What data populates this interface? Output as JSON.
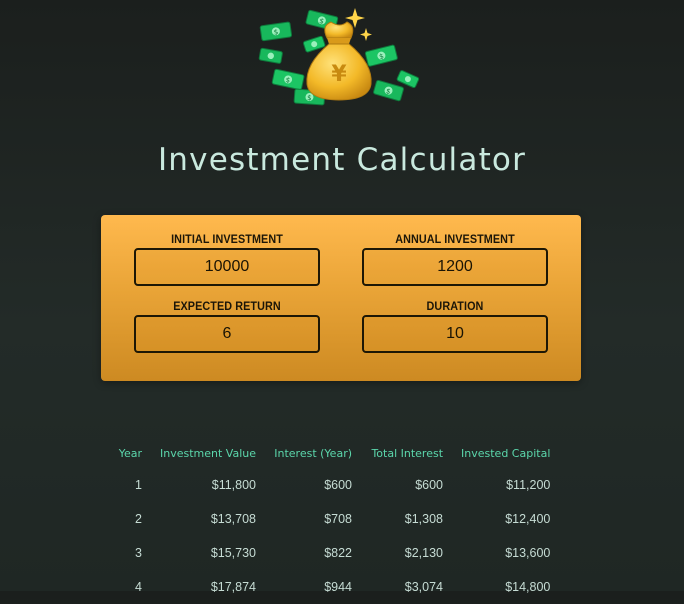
{
  "app": {
    "title": "Investment Calculator",
    "logo_icon": "money-bag-with-flying-cash-icon"
  },
  "inputs": {
    "initial_investment": {
      "label": "INITIAL INVESTMENT",
      "value": "10000"
    },
    "annual_investment": {
      "label": "ANNUAL INVESTMENT",
      "value": "1200"
    },
    "expected_return": {
      "label": "EXPECTED RETURN",
      "value": "6"
    },
    "duration": {
      "label": "DURATION",
      "value": "10"
    }
  },
  "results": {
    "headers": [
      "Year",
      "Investment Value",
      "Interest (Year)",
      "Total Interest",
      "Invested Capital"
    ],
    "rows": [
      [
        "1",
        "$11,800",
        "$600",
        "$600",
        "$11,200"
      ],
      [
        "2",
        "$13,708",
        "$708",
        "$1,308",
        "$12,400"
      ],
      [
        "3",
        "$15,730",
        "$822",
        "$2,130",
        "$13,600"
      ],
      [
        "4",
        "$17,874",
        "$944",
        "$3,074",
        "$14,800"
      ]
    ]
  },
  "colors": {
    "background": "#1f2522",
    "title": "#c9e9de",
    "panel_top": "#ffb94e",
    "panel_bottom": "#cd8a22",
    "table_header": "#5bd6ab",
    "table_text": "#c6dcd4"
  }
}
